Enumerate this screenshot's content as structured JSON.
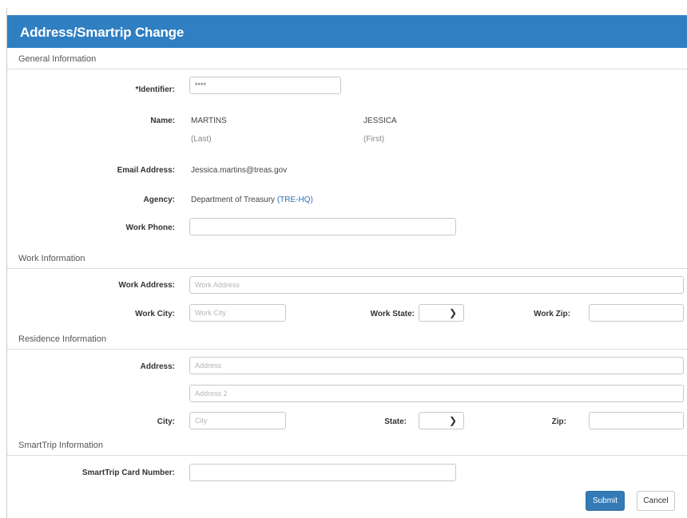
{
  "form": {
    "title": "Address/Smartrip Change"
  },
  "general": {
    "section_title": "General Information",
    "identifier_label": "*Identifier:",
    "identifier_value": "****",
    "name_label": "Name:",
    "last_name": "MARTINS",
    "last_caption": "(Last)",
    "first_name": "JESSICA",
    "first_caption": "(First)",
    "email_label": "Email Address:",
    "email_value": "Jessica.martins@treas.gov",
    "agency_label": "Agency:",
    "agency_name": "Department of Treasury",
    "agency_code": "(TRE-HQ)",
    "work_phone_label": "Work Phone:",
    "work_phone_value": ""
  },
  "work": {
    "section_title": "Work Information",
    "address_label": "Work Address:",
    "address_placeholder": "Work Address",
    "city_label": "Work City:",
    "city_placeholder": "Work City",
    "state_label": "Work State:",
    "state_value": "",
    "zip_label": "Work Zip:",
    "zip_value": ""
  },
  "residence": {
    "section_title": "Residence Information",
    "address_label": "Address:",
    "address_placeholder": "Address",
    "address2_placeholder": "Address 2",
    "city_label": "City:",
    "city_placeholder": "City",
    "state_label": "State:",
    "state_value": "",
    "zip_label": "Zip:",
    "zip_value": ""
  },
  "smarttrip": {
    "section_title": "SmartTrip Information",
    "card_label": "SmartTrip Card Number:",
    "card_value": ""
  },
  "actions": {
    "submit_label": "Submit",
    "cancel_label": "Cancel"
  },
  "colors": {
    "header": "#2f7fc2",
    "primary_button": "#337ab7",
    "link": "#2f6fb5"
  },
  "icons": {
    "select_chevron": "chevron-down-icon"
  }
}
